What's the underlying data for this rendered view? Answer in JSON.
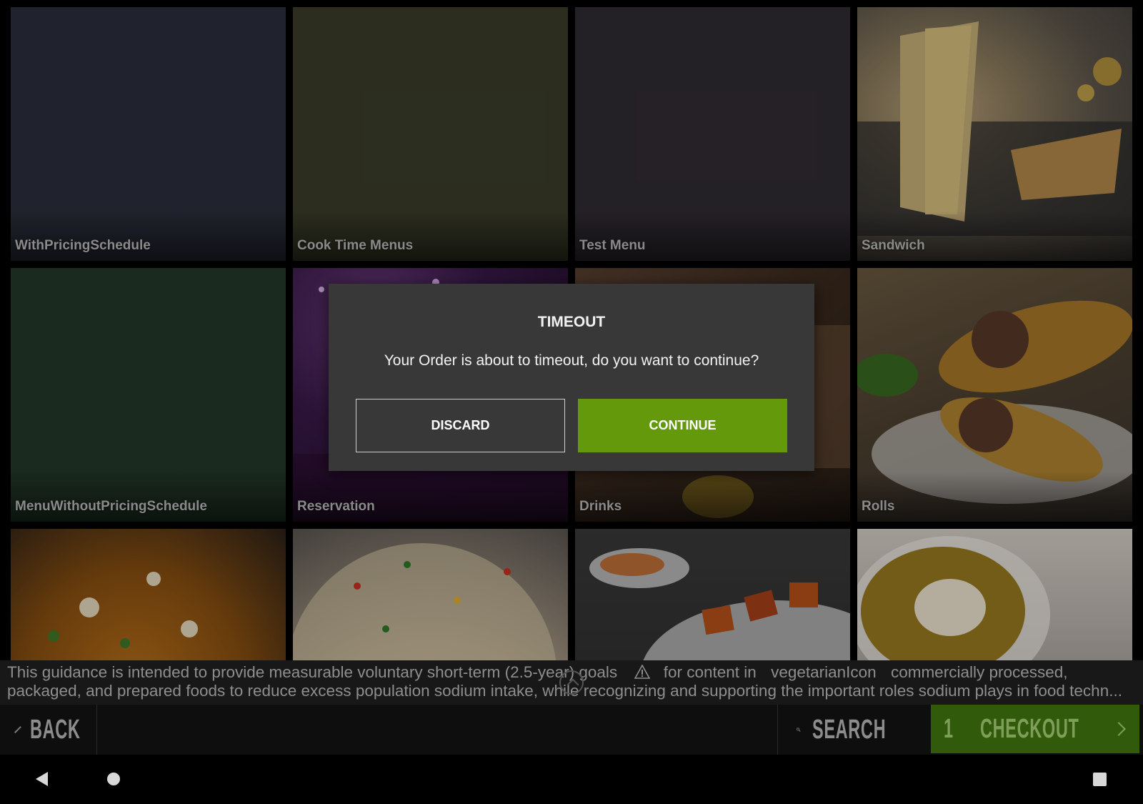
{
  "tiles": [
    {
      "label": "WithPricingSchedule",
      "bg": "#2b2f3c"
    },
    {
      "label": "Cook Time Menus",
      "bg": "#3b3d29"
    },
    {
      "label": "Test Menu",
      "bg": "#312c33"
    },
    {
      "label": "Sandwich",
      "bg": "#5d554b"
    },
    {
      "label": "MenuWithoutPricingSchedule",
      "bg": "#233829"
    },
    {
      "label": "Reservation",
      "bg": "#3a1a3a"
    },
    {
      "label": "Drinks",
      "bg": "#3a2a1e"
    },
    {
      "label": "Rolls",
      "bg": "#4d4030"
    },
    {
      "label": "",
      "bg": "#6a3d10"
    },
    {
      "label": "",
      "bg": "#56504a"
    },
    {
      "label": "",
      "bg": "#3a3a3a"
    },
    {
      "label": "",
      "bg": "#4a3c24"
    }
  ],
  "info_bar": {
    "line1_a": "This guidance is intended to provide measurable voluntary short-term (2.5-year) goals",
    "line1_b": "for content in",
    "veg_icon_label": "vegetarianIcon",
    "line1_c": "commercially processed,",
    "line2": "packaged, and prepared foods to reduce excess population sodium intake, while recognizing and supporting the important roles sodium plays in food techn..."
  },
  "bottom_bar": {
    "back_label": "BACK",
    "search_label": "SEARCH",
    "cart_count": "1",
    "checkout_label": "CHECKOUT"
  },
  "dialog": {
    "title": "TIMEOUT",
    "message": "Your Order is about to timeout, do you want to continue?",
    "discard_label": "DISCARD",
    "continue_label": "CONTINUE"
  },
  "colors": {
    "accent_green": "#64990c",
    "checkout_green": "#315b0a",
    "dialog_bg": "#383838"
  }
}
